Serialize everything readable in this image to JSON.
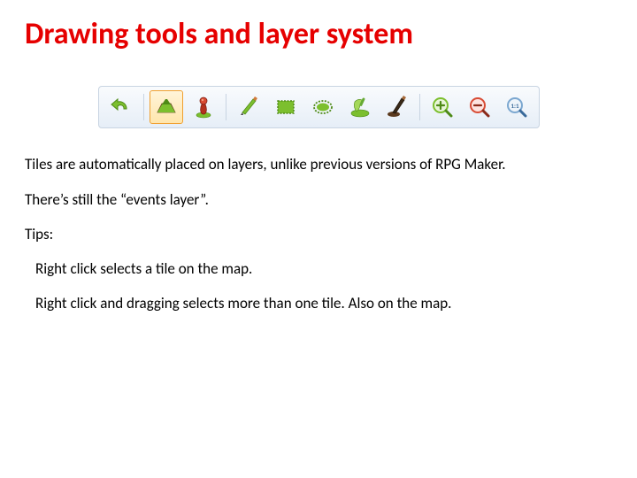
{
  "title": "Drawing tools and layer system",
  "toolbar": {
    "tools": [
      {
        "name": "undo-icon"
      },
      {
        "name": "map-mode-icon"
      },
      {
        "name": "event-mode-icon"
      },
      {
        "name": "pencil-icon"
      },
      {
        "name": "rectangle-icon"
      },
      {
        "name": "ellipse-icon"
      },
      {
        "name": "floodfill-icon"
      },
      {
        "name": "shadowpen-icon"
      },
      {
        "name": "zoom-in-icon"
      },
      {
        "name": "zoom-out-icon"
      },
      {
        "name": "zoom-actual-icon"
      }
    ]
  },
  "paragraphs": {
    "p1": "Tiles are automatically placed on layers, unlike previous versions of RPG Maker.",
    "p2": "There’s still the “events layer”.",
    "p3": "Tips:",
    "tip1": "Right click selects a tile on the map.",
    "tip2": "Right click and dragging selects more than one tile. Also on the map."
  }
}
